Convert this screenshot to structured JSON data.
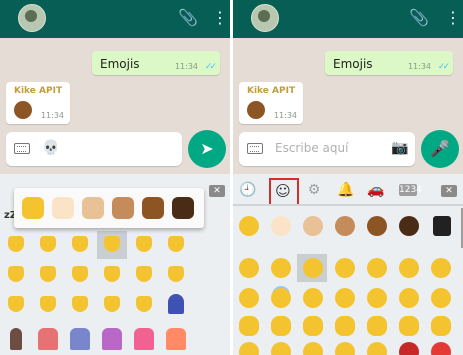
{
  "colors": {
    "header": "#075e54",
    "out_bubble": "#dcf8c6",
    "in_bubble": "#ffffff",
    "accent": "#00a884",
    "highlight": "#d32f2f"
  },
  "left": {
    "out_message": {
      "text": "Emojis",
      "time": "11:34",
      "ticks": "✓✓"
    },
    "in_message": {
      "sender": "Kike APIT",
      "time": "11:34"
    },
    "input": {
      "value": "💀"
    },
    "send_icon": "send-icon",
    "delete_label": "✕",
    "zz_label": "zZ"
  },
  "right": {
    "out_message": {
      "text": "Emojis",
      "time": "11:34",
      "ticks": "✓✓"
    },
    "in_message": {
      "sender": "Kike APIT",
      "time": "11:34"
    },
    "input": {
      "placeholder": "Escribe aquí"
    },
    "mic_icon": "mic-icon",
    "delete_label": "✕",
    "tab_labels": {
      "recent": "🕘",
      "smileys": "☺",
      "settings": "⚙",
      "bell": "🔔",
      "car": "🚗",
      "numbers": "1234"
    }
  }
}
